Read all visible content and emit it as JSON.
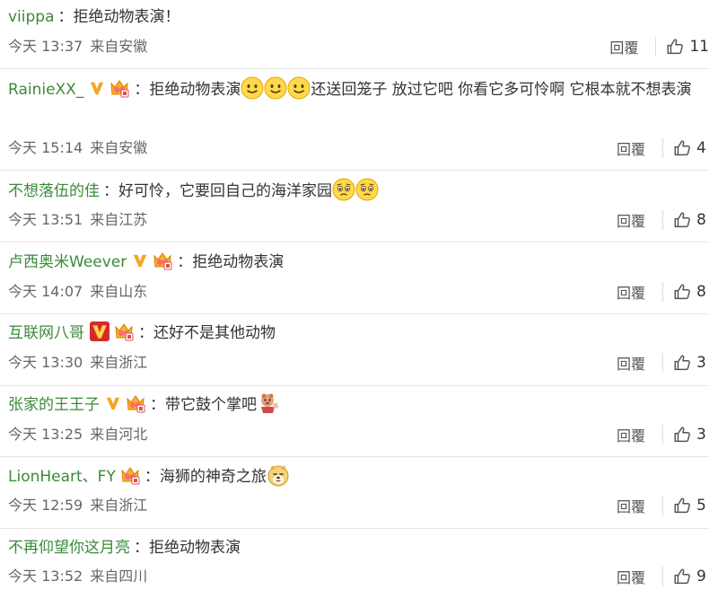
{
  "comments": [
    {
      "user": "viippa",
      "text": "拒绝动物表演！",
      "time": "今天 13:37",
      "location": "来自安徽",
      "reply": "回覆",
      "likes": "11"
    },
    {
      "user": "RainieXX_",
      "text_before": "拒绝动物表演",
      "text_after": "还送回笼子 放过它吧 你看它多可怜啊 它根本就不想表演",
      "time": "今天 15:14",
      "location": "来自安徽",
      "reply": "回覆",
      "likes": "4"
    },
    {
      "user": "不想落伍的佳",
      "text": "好可怜，它要回自己的海洋家园",
      "time": "今天 13:51",
      "location": "来自江苏",
      "reply": "回覆",
      "likes": "8"
    },
    {
      "user": "卢西奥米Weever",
      "text": "拒绝动物表演",
      "time": "今天 14:07",
      "location": "来自山东",
      "reply": "回覆",
      "likes": "8"
    },
    {
      "user": "互联网八哥",
      "text": "还好不是其他动物",
      "time": "今天 13:30",
      "location": "来自浙江",
      "reply": "回覆",
      "likes": "3"
    },
    {
      "user": "张家的王王子",
      "text": "带它鼓个掌吧",
      "time": "今天 13:25",
      "location": "来自河北",
      "reply": "回覆",
      "likes": "3"
    },
    {
      "user": "LionHeart、FY",
      "text": "海狮的神奇之旅",
      "time": "今天 12:59",
      "location": "来自浙江",
      "reply": "回覆",
      "likes": "5"
    },
    {
      "user": "不再仰望你这月亮",
      "text": "拒绝动物表演",
      "time": "今天 13:52",
      "location": "来自四川",
      "reply": "回覆",
      "likes": "9"
    }
  ],
  "colors": {
    "username": "#3a8a3a",
    "meta": "#666666",
    "divider": "#e6e6e6",
    "v_badge": "#f5a623",
    "red_v_badge": "#d32a2a"
  }
}
